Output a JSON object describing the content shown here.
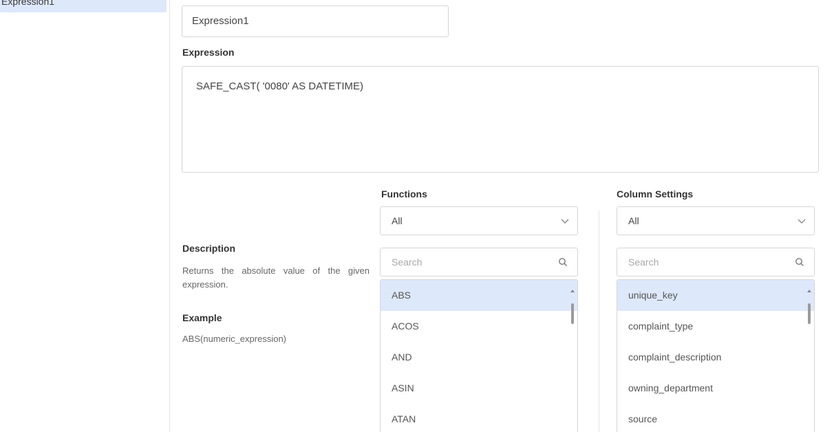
{
  "sidebar": {
    "selected_item": "Expression1"
  },
  "name_field": {
    "value": "Expression1"
  },
  "expression": {
    "label": "Expression",
    "value": "SAFE_CAST( '0080' AS DATETIME)"
  },
  "description": {
    "label": "Description",
    "text": "Returns the absolute value of the given expression.",
    "example_label": "Example",
    "example_text": "ABS(numeric_expression)"
  },
  "functions": {
    "title": "Functions",
    "filter_value": "All",
    "search_placeholder": "Search",
    "items": [
      {
        "label": "ABS",
        "selected": true
      },
      {
        "label": "ACOS",
        "selected": false
      },
      {
        "label": "AND",
        "selected": false
      },
      {
        "label": "ASIN",
        "selected": false
      },
      {
        "label": "ATAN",
        "selected": false
      }
    ]
  },
  "columns": {
    "title": "Column Settings",
    "filter_value": "All",
    "search_placeholder": "Search",
    "items": [
      {
        "label": "unique_key",
        "selected": true
      },
      {
        "label": "complaint_type",
        "selected": false
      },
      {
        "label": "complaint_description",
        "selected": false
      },
      {
        "label": "owning_department",
        "selected": false
      },
      {
        "label": "source",
        "selected": false
      }
    ]
  },
  "colors": {
    "selected_bg": "#dde8fb",
    "border": "#d6d6d6"
  }
}
